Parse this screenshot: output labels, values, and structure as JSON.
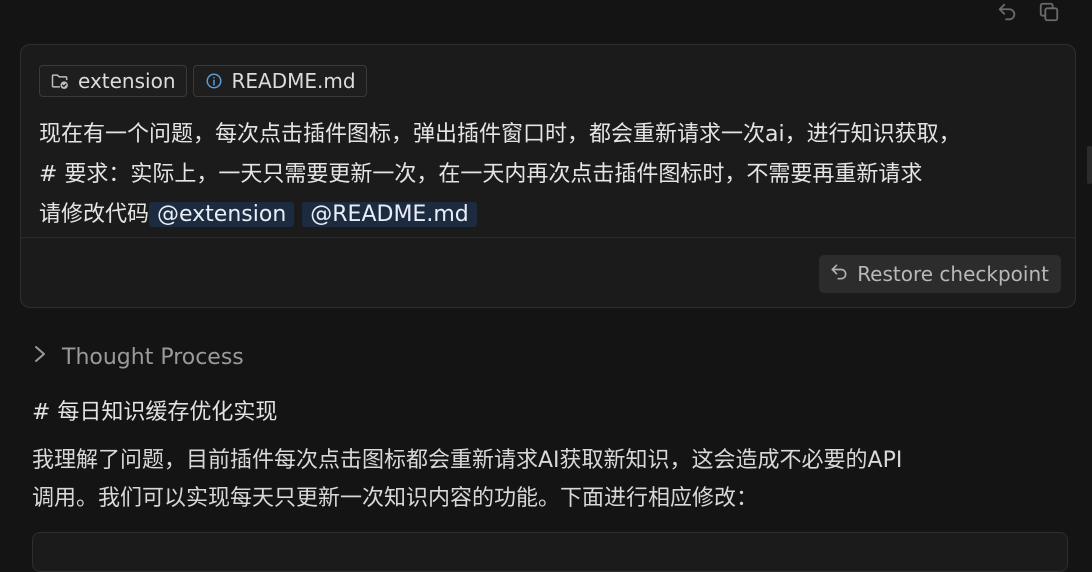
{
  "icons": {
    "undo": "undo-icon",
    "copy": "copy-icon",
    "folder": "folder-check-icon",
    "info": "info-icon",
    "restore": "restore-arrow-icon",
    "chevron": "chevron-right-icon"
  },
  "context_chips": [
    {
      "label": "extension"
    },
    {
      "label": "README.md"
    }
  ],
  "user_message": {
    "line1": "现在有一个问题，每次点击插件图标，弹出插件窗口时，都会重新请求一次ai，进行知识获取，",
    "line2": "# 要求：实际上，一天只需要更新一次，在一天内再次点击插件图标时，不需要再重新请求",
    "line3_prefix": "请修改代码",
    "mentions": [
      "@extension",
      "@README.md"
    ]
  },
  "restore_checkpoint_label": "Restore checkpoint",
  "thought_process_label": "Thought Process",
  "response": {
    "heading": "# 每日知识缓存优化实现",
    "para_line1": "我理解了问题，目前插件每次点击图标都会重新请求AI获取新知识，这会造成不必要的API",
    "para_line2": "调用。我们可以实现每天只更新一次知识内容的功能。下面进行相应修改："
  },
  "colors": {
    "background": "#141414",
    "card": "#1b1b1b",
    "mention_bg": "#1d2b40"
  }
}
